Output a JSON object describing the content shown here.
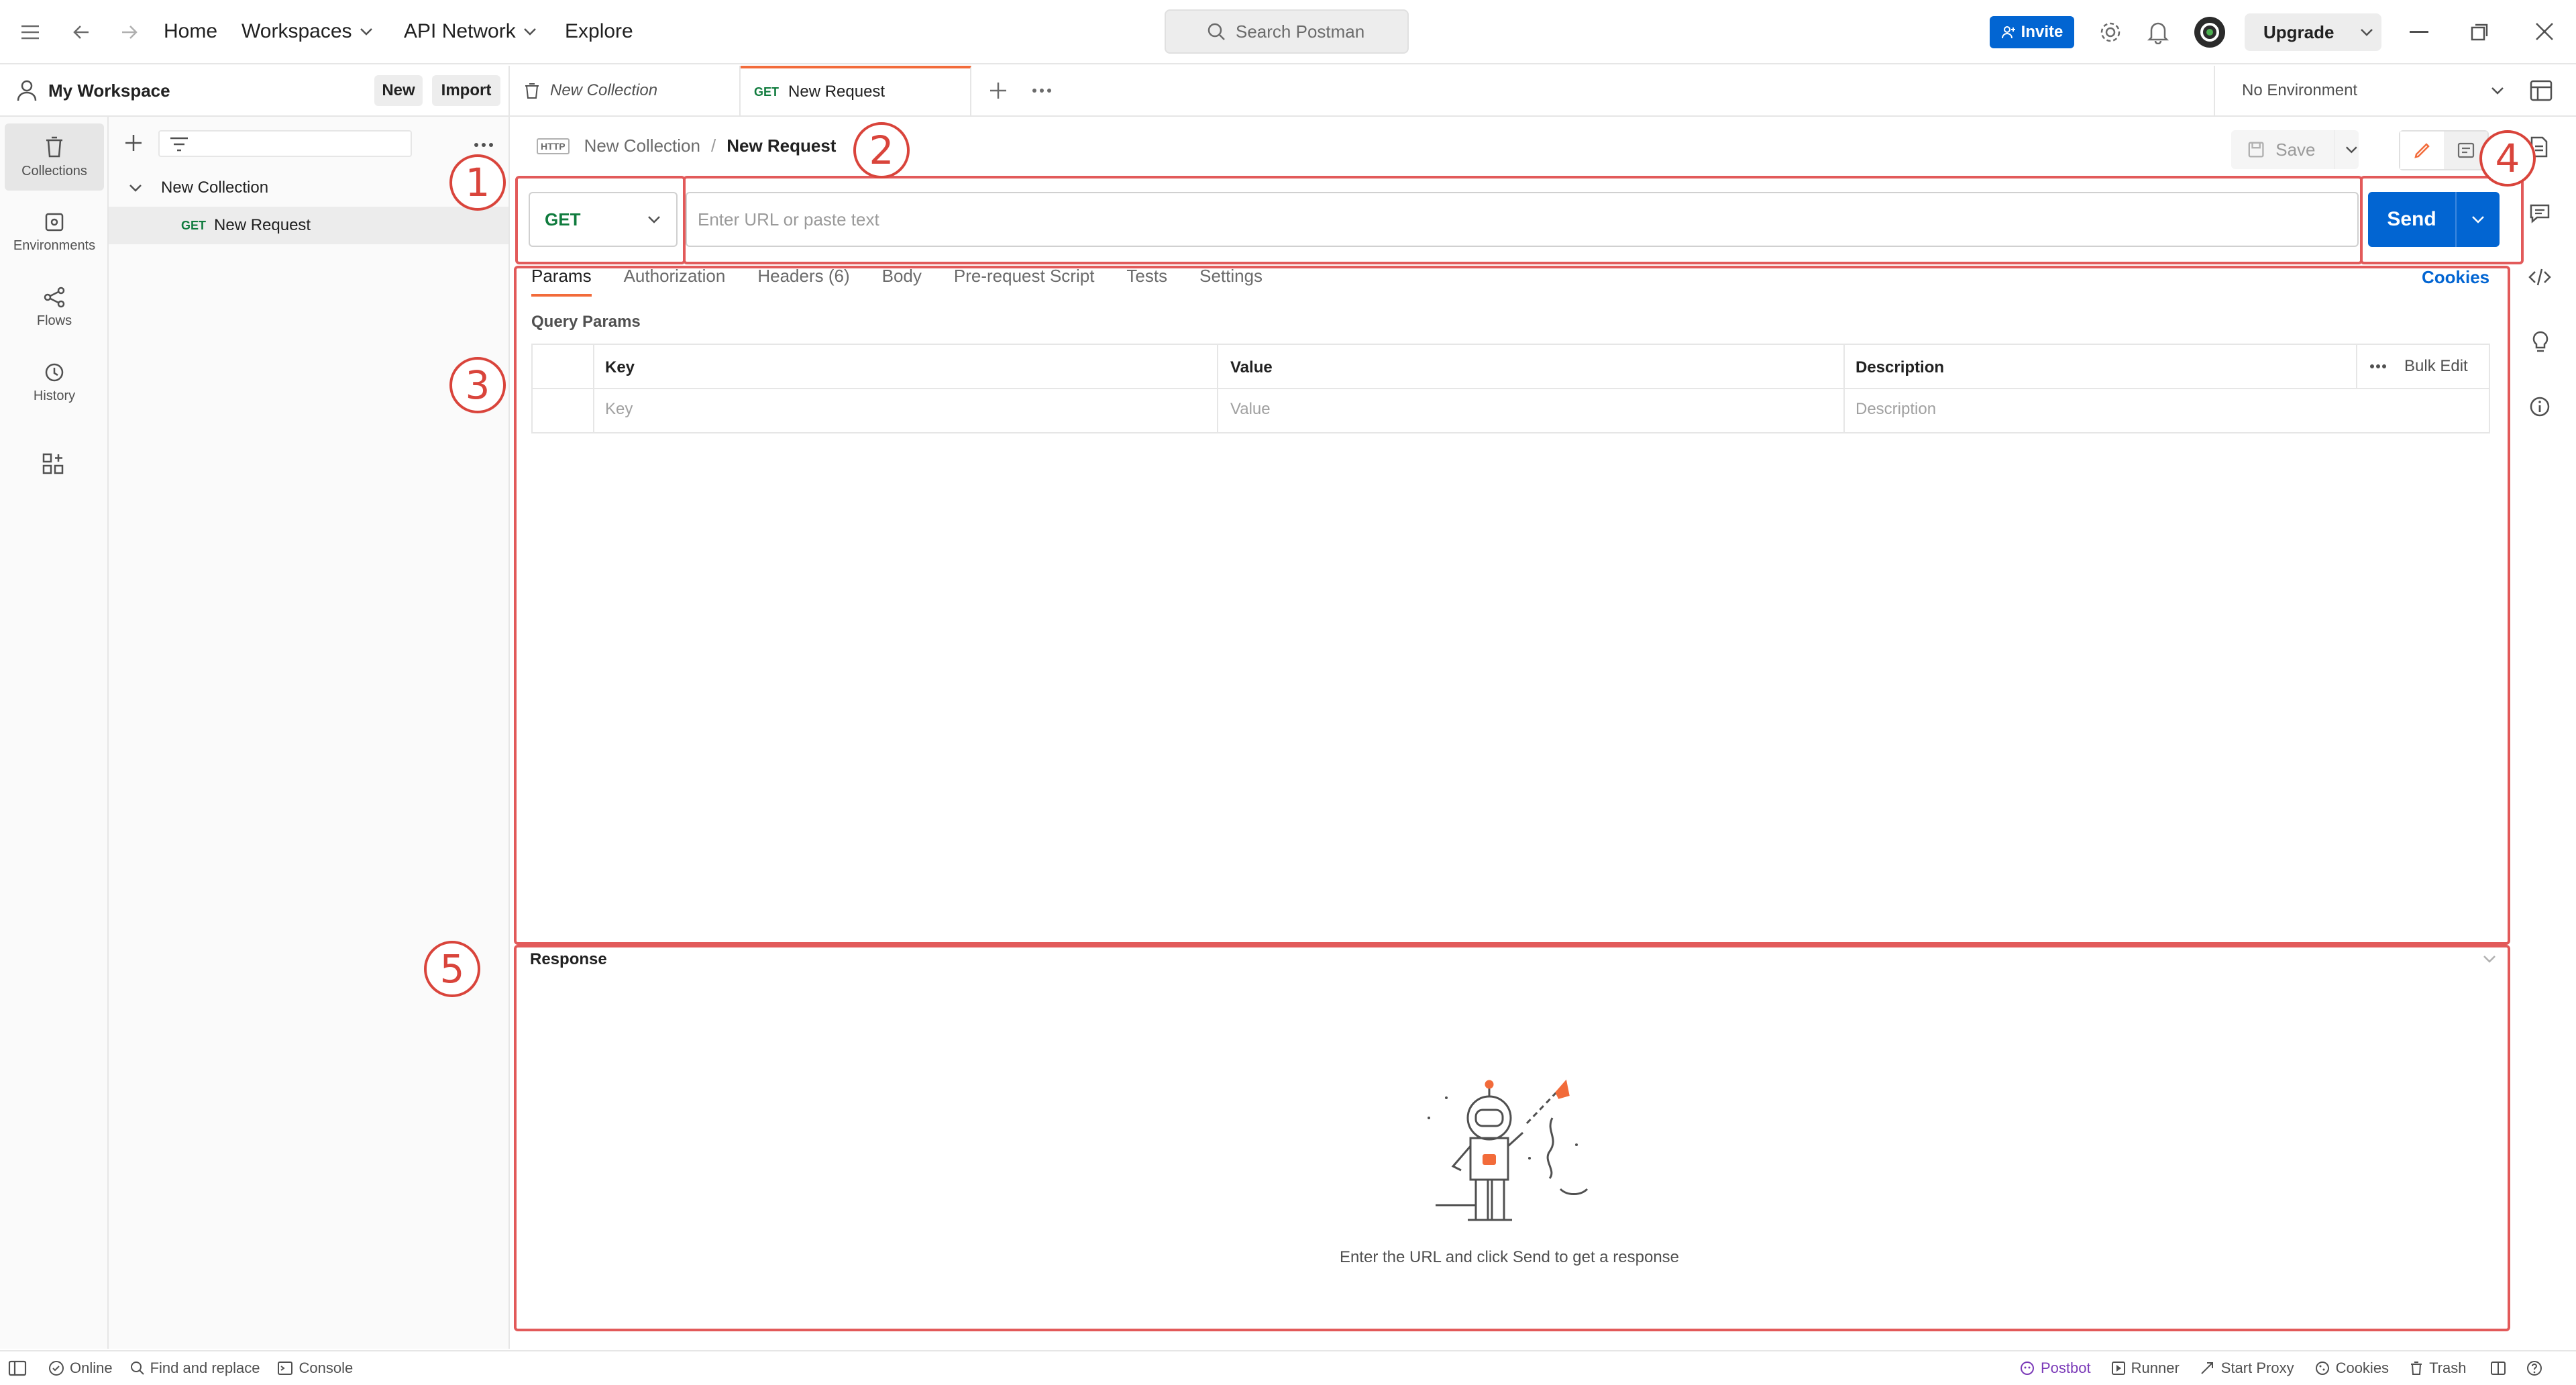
{
  "topbar": {
    "nav": {
      "home": "Home",
      "workspaces": "Workspaces",
      "api_network": "API Network",
      "explore": "Explore"
    },
    "search_placeholder": "Search Postman",
    "invite_label": "Invite",
    "upgrade_label": "Upgrade"
  },
  "workspace": {
    "name": "My Workspace",
    "new_label": "New",
    "import_label": "Import"
  },
  "rail": [
    {
      "label": "Collections",
      "icon": "trash-can-icon"
    },
    {
      "label": "Environments",
      "icon": "environment-icon"
    },
    {
      "label": "Flows",
      "icon": "flows-icon"
    },
    {
      "label": "History",
      "icon": "history-icon"
    }
  ],
  "sidebar": {
    "collection_name": "New Collection",
    "request_method": "GET",
    "request_name": "New Request"
  },
  "tabs": [
    {
      "label": "New Collection"
    },
    {
      "method": "GET",
      "label": "New Request"
    }
  ],
  "environment": {
    "selected": "No Environment"
  },
  "breadcrumb": {
    "badge": "HTTP",
    "collection": "New Collection",
    "sep": "/",
    "request": "New Request"
  },
  "save_label": "Save",
  "request": {
    "method": "GET",
    "url_placeholder": "Enter URL or paste text",
    "send_label": "Send"
  },
  "subtabs": [
    "Params",
    "Authorization",
    "Headers (6)",
    "Body",
    "Pre-request Script",
    "Tests",
    "Settings"
  ],
  "cookies_label": "Cookies",
  "params": {
    "title": "Query Params",
    "headers": {
      "key": "Key",
      "value": "Value",
      "description": "Description"
    },
    "placeholders": {
      "key": "Key",
      "value": "Value",
      "description": "Description"
    },
    "bulk_edit": "Bulk Edit"
  },
  "response": {
    "title": "Response",
    "empty_message": "Enter the URL and click Send to get a response"
  },
  "annotations": [
    "1",
    "2",
    "3",
    "4",
    "5"
  ],
  "statusbar": {
    "left": [
      "Online",
      "Find and replace",
      "Console"
    ],
    "right": [
      "Postbot",
      "Runner",
      "Start Proxy",
      "Cookies",
      "Trash"
    ]
  },
  "colors": {
    "accent": "#f26b3a",
    "primary": "#0265d2",
    "get_method": "#0f7b3d",
    "annotation": "#e25a5a"
  }
}
